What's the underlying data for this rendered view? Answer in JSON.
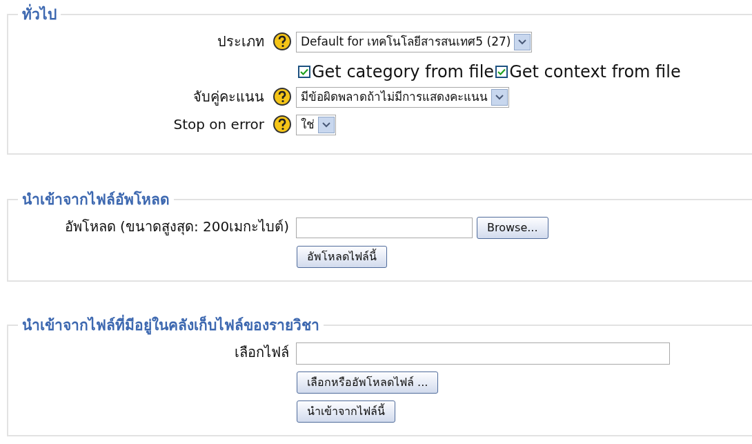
{
  "sections": [
    {
      "legend": "ทั่วไป",
      "rows": [
        {
          "kind": "select",
          "label": "ประเภท",
          "help": true,
          "value": "Default for เทคโนโลยีสารสนเทศ5 (27)"
        },
        {
          "kind": "checkboxes",
          "items": [
            {
              "label": "Get category from file",
              "checked": true
            },
            {
              "label": "Get context from file",
              "checked": true
            }
          ]
        },
        {
          "kind": "select",
          "label": "จับคู่คะแนน",
          "help": true,
          "value": "มีข้อผิดพลาดถ้าไม่มีการแสดงคะแนน"
        },
        {
          "kind": "select",
          "label": "Stop on error",
          "help": true,
          "value": "ใช่"
        }
      ]
    },
    {
      "legend": "นำเข้าจากไฟล์อัพโหลด",
      "rows": [
        {
          "kind": "file",
          "label": "อัพโหลด (ขนาดสูงสุด: 200เมกะไบต์)",
          "help": false,
          "button": "Browse..."
        },
        {
          "kind": "button",
          "label_button": "อัพโหลดไฟล์นี้"
        }
      ]
    },
    {
      "legend": "นำเข้าจากไฟล์ที่มีอยู่ในคลังเก็บไฟล์ของรายวิชา",
      "rows": [
        {
          "kind": "text",
          "label": "เลือกไฟล์",
          "help": false
        },
        {
          "kind": "button",
          "label_button": "เลือกหรืออัพโหลดไฟล์ ..."
        },
        {
          "kind": "button",
          "label_button": "นำเข้าจากไฟล์นี้"
        }
      ]
    }
  ]
}
